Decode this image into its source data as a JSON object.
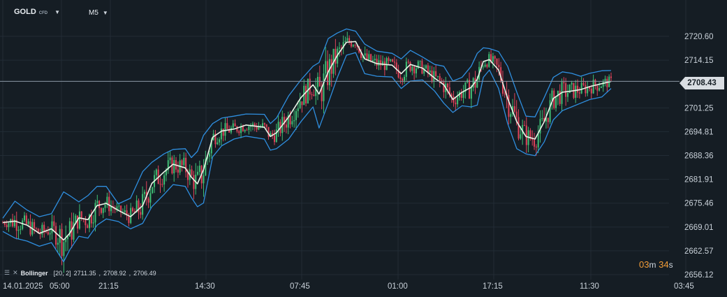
{
  "header": {
    "symbol": "GOLD",
    "symbol_badge": "CFD",
    "timeframe": "M5"
  },
  "indicator": {
    "name": "Bollinger",
    "params": "[20, 2]",
    "upper": "2711.35",
    "middle": "2708.92",
    "lower": "2706.49"
  },
  "timer": {
    "minutes": "03",
    "minutes_unit": "m",
    "seconds": "34",
    "seconds_unit": "s"
  },
  "colors": {
    "background": "#151d24",
    "grid": "#222c35",
    "bull": "#3fbf75",
    "bear": "#e0435a",
    "bollinger_band": "#2f8fe0",
    "bollinger_mid": "#e9f3e6",
    "price_line": "#8a96a2",
    "timer": "#f29d38"
  },
  "chart_data": {
    "type": "candlestick",
    "instrument": "GOLD CFD",
    "timeframe": "M5",
    "current_price": 2708.43,
    "current_price_label": "2708.43",
    "y_ticks": [
      "2720.60",
      "2714.15",
      "2708.43",
      "2701.25",
      "2694.81",
      "2688.36",
      "2681.91",
      "2675.46",
      "2669.01",
      "2662.57",
      "2656.12"
    ],
    "y_tick_values": [
      2720.6,
      2714.15,
      2708.43,
      2701.25,
      2694.81,
      2688.36,
      2681.91,
      2675.46,
      2669.01,
      2662.57,
      2656.12
    ],
    "x_ticks": [
      "14.01.2025",
      "05:00",
      "21:15",
      "14:30",
      "07:45",
      "01:00",
      "17:15",
      "11:30",
      "03:45"
    ],
    "ylim": [
      2656.12,
      2723.5
    ],
    "grid": true,
    "series": [
      {
        "name": "Bollinger",
        "role": "middle",
        "points": [
          [
            0.0,
            2670.2
          ],
          [
            0.02,
            2670.6
          ],
          [
            0.04,
            2669.5
          ],
          [
            0.06,
            2667.3
          ],
          [
            0.08,
            2668.5
          ],
          [
            0.1,
            2665.5
          ],
          [
            0.11,
            2667.3
          ],
          [
            0.125,
            2671.5
          ],
          [
            0.14,
            2671.0
          ],
          [
            0.155,
            2674.8
          ],
          [
            0.17,
            2675.4
          ],
          [
            0.19,
            2673.5
          ],
          [
            0.21,
            2671.8
          ],
          [
            0.23,
            2674.8
          ],
          [
            0.245,
            2680.8
          ],
          [
            0.265,
            2683.9
          ],
          [
            0.28,
            2686.0
          ],
          [
            0.3,
            2685.0
          ],
          [
            0.31,
            2682.5
          ],
          [
            0.32,
            2680.7
          ],
          [
            0.33,
            2684.5
          ],
          [
            0.345,
            2693.3
          ],
          [
            0.36,
            2695.0
          ],
          [
            0.38,
            2695.5
          ],
          [
            0.4,
            2696.6
          ],
          [
            0.43,
            2696.0
          ],
          [
            0.44,
            2693.5
          ],
          [
            0.45,
            2694.5
          ],
          [
            0.47,
            2698.8
          ],
          [
            0.49,
            2704.0
          ],
          [
            0.51,
            2707.5
          ],
          [
            0.52,
            2705.0
          ],
          [
            0.535,
            2711.0
          ],
          [
            0.55,
            2715.5
          ],
          [
            0.565,
            2719.0
          ],
          [
            0.58,
            2719.2
          ],
          [
            0.595,
            2714.5
          ],
          [
            0.615,
            2713.2
          ],
          [
            0.64,
            2712.8
          ],
          [
            0.655,
            2710.5
          ],
          [
            0.67,
            2713.0
          ],
          [
            0.69,
            2712.0
          ],
          [
            0.71,
            2709.3
          ],
          [
            0.725,
            2707.5
          ],
          [
            0.74,
            2703.5
          ],
          [
            0.755,
            2705.5
          ],
          [
            0.77,
            2706.8
          ],
          [
            0.78,
            2709.0
          ],
          [
            0.79,
            2713.8
          ],
          [
            0.8,
            2714.3
          ],
          [
            0.815,
            2711.5
          ],
          [
            0.83,
            2703.8
          ],
          [
            0.845,
            2697.5
          ],
          [
            0.86,
            2693.5
          ],
          [
            0.875,
            2692.8
          ],
          [
            0.89,
            2697.5
          ],
          [
            0.905,
            2703.8
          ],
          [
            0.92,
            2705.5
          ],
          [
            0.935,
            2705.8
          ],
          [
            0.95,
            2706.2
          ],
          [
            0.965,
            2707.0
          ],
          [
            0.985,
            2707.8
          ],
          [
            1.0,
            2708.4
          ]
        ]
      },
      {
        "name": "Bollinger",
        "role": "upper",
        "points": [
          [
            0.0,
            2671.4
          ],
          [
            0.02,
            2676.0
          ],
          [
            0.04,
            2673.6
          ],
          [
            0.06,
            2671.8
          ],
          [
            0.08,
            2672.6
          ],
          [
            0.1,
            2678.5
          ],
          [
            0.11,
            2677.5
          ],
          [
            0.125,
            2675.8
          ],
          [
            0.14,
            2677.5
          ],
          [
            0.155,
            2680.0
          ],
          [
            0.17,
            2680.0
          ],
          [
            0.19,
            2675.3
          ],
          [
            0.21,
            2676.8
          ],
          [
            0.23,
            2684.0
          ],
          [
            0.245,
            2686.5
          ],
          [
            0.265,
            2688.8
          ],
          [
            0.28,
            2690.0
          ],
          [
            0.3,
            2690.2
          ],
          [
            0.31,
            2687.8
          ],
          [
            0.32,
            2689.5
          ],
          [
            0.33,
            2693.8
          ],
          [
            0.345,
            2697.0
          ],
          [
            0.36,
            2698.5
          ],
          [
            0.38,
            2699.0
          ],
          [
            0.4,
            2699.6
          ],
          [
            0.43,
            2699.5
          ],
          [
            0.44,
            2697.0
          ],
          [
            0.45,
            2698.5
          ],
          [
            0.47,
            2704.5
          ],
          [
            0.49,
            2708.8
          ],
          [
            0.51,
            2712.5
          ],
          [
            0.52,
            2713.5
          ],
          [
            0.535,
            2720.0
          ],
          [
            0.55,
            2721.5
          ],
          [
            0.565,
            2722.6
          ],
          [
            0.58,
            2722.0
          ],
          [
            0.595,
            2718.5
          ],
          [
            0.615,
            2716.6
          ],
          [
            0.64,
            2716.0
          ],
          [
            0.655,
            2714.5
          ],
          [
            0.67,
            2716.8
          ],
          [
            0.69,
            2715.0
          ],
          [
            0.71,
            2713.0
          ],
          [
            0.725,
            2712.5
          ],
          [
            0.74,
            2708.5
          ],
          [
            0.755,
            2709.5
          ],
          [
            0.77,
            2712.5
          ],
          [
            0.78,
            2716.0
          ],
          [
            0.79,
            2717.5
          ],
          [
            0.8,
            2717.3
          ],
          [
            0.815,
            2716.5
          ],
          [
            0.83,
            2712.5
          ],
          [
            0.845,
            2705.5
          ],
          [
            0.86,
            2699.0
          ],
          [
            0.875,
            2698.8
          ],
          [
            0.89,
            2704.0
          ],
          [
            0.905,
            2709.5
          ],
          [
            0.92,
            2711.0
          ],
          [
            0.935,
            2710.6
          ],
          [
            0.95,
            2709.8
          ],
          [
            0.965,
            2710.6
          ],
          [
            0.985,
            2711.3
          ],
          [
            1.0,
            2711.35
          ]
        ]
      },
      {
        "name": "Bollinger",
        "role": "lower",
        "points": [
          [
            0.0,
            2667.8
          ],
          [
            0.02,
            2666.0
          ],
          [
            0.04,
            2665.2
          ],
          [
            0.06,
            2663.8
          ],
          [
            0.08,
            2664.8
          ],
          [
            0.1,
            2659.6
          ],
          [
            0.11,
            2662.8
          ],
          [
            0.125,
            2666.5
          ],
          [
            0.14,
            2666.0
          ],
          [
            0.155,
            2669.5
          ],
          [
            0.17,
            2671.2
          ],
          [
            0.19,
            2670.5
          ],
          [
            0.21,
            2668.5
          ],
          [
            0.23,
            2670.0
          ],
          [
            0.245,
            2674.5
          ],
          [
            0.265,
            2677.8
          ],
          [
            0.28,
            2680.5
          ],
          [
            0.3,
            2680.0
          ],
          [
            0.31,
            2677.0
          ],
          [
            0.32,
            2674.5
          ],
          [
            0.33,
            2675.5
          ],
          [
            0.345,
            2688.0
          ],
          [
            0.36,
            2691.0
          ],
          [
            0.38,
            2692.8
          ],
          [
            0.4,
            2693.6
          ],
          [
            0.43,
            2692.8
          ],
          [
            0.44,
            2689.8
          ],
          [
            0.45,
            2690.2
          ],
          [
            0.47,
            2692.8
          ],
          [
            0.49,
            2697.5
          ],
          [
            0.51,
            2701.5
          ],
          [
            0.52,
            2695.8
          ],
          [
            0.535,
            2702.5
          ],
          [
            0.55,
            2709.5
          ],
          [
            0.565,
            2715.5
          ],
          [
            0.58,
            2716.2
          ],
          [
            0.595,
            2710.5
          ],
          [
            0.615,
            2709.8
          ],
          [
            0.64,
            2709.6
          ],
          [
            0.655,
            2706.5
          ],
          [
            0.67,
            2708.5
          ],
          [
            0.69,
            2708.8
          ],
          [
            0.71,
            2705.8
          ],
          [
            0.725,
            2702.5
          ],
          [
            0.74,
            2700.0
          ],
          [
            0.755,
            2701.8
          ],
          [
            0.77,
            2701.5
          ],
          [
            0.78,
            2702.0
          ],
          [
            0.79,
            2709.5
          ],
          [
            0.8,
            2711.5
          ],
          [
            0.815,
            2706.5
          ],
          [
            0.83,
            2697.0
          ],
          [
            0.845,
            2690.2
          ],
          [
            0.86,
            2688.8
          ],
          [
            0.875,
            2688.3
          ],
          [
            0.89,
            2692.0
          ],
          [
            0.905,
            2698.0
          ],
          [
            0.92,
            2700.5
          ],
          [
            0.935,
            2701.5
          ],
          [
            0.95,
            2702.5
          ],
          [
            0.965,
            2703.5
          ],
          [
            0.985,
            2704.2
          ],
          [
            1.0,
            2706.49
          ]
        ]
      }
    ]
  }
}
